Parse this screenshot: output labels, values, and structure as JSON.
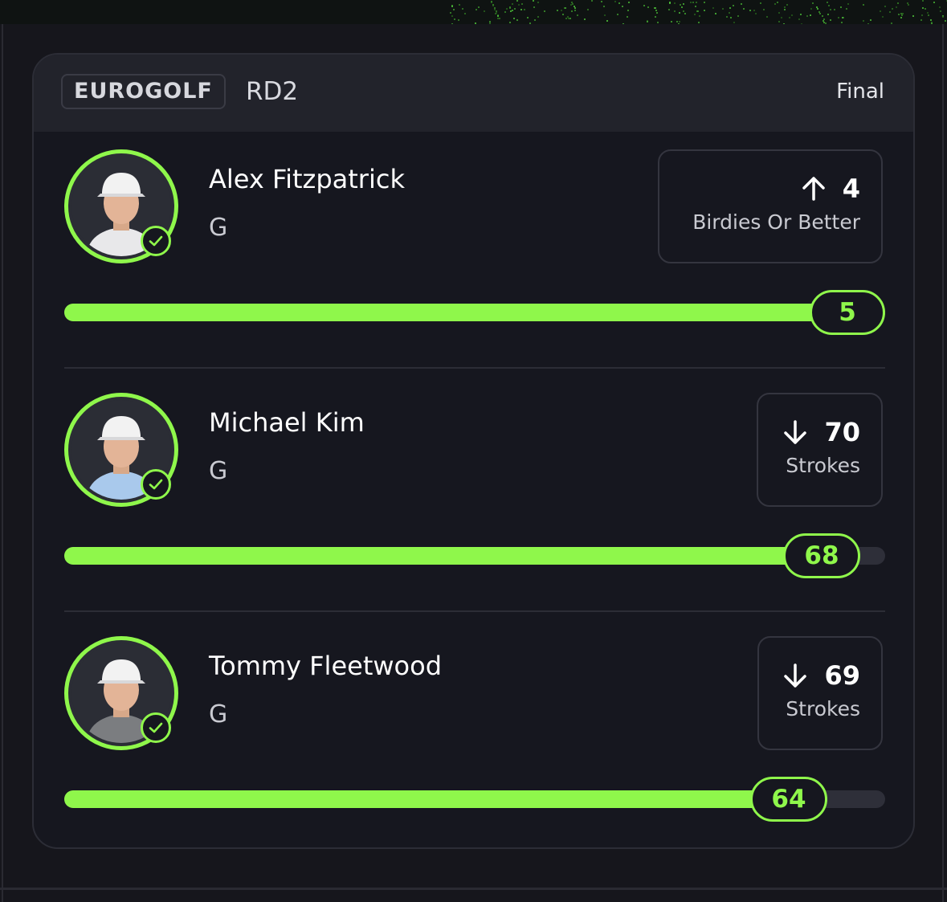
{
  "header": {
    "league": "EUROGOLF",
    "round": "RD2",
    "status": "Final"
  },
  "players": [
    {
      "name": "Alex Fitzpatrick",
      "position": "G",
      "direction": "up",
      "line": "4",
      "stat_label": "Birdies Or Better",
      "current_value": "5",
      "progress_fraction": 1.0,
      "shirt_color": "#e8e8ea",
      "cap_color": "#f2f2f2"
    },
    {
      "name": "Michael Kim",
      "position": "G",
      "direction": "down",
      "line": "70",
      "stat_label": "Strokes",
      "current_value": "68",
      "progress_fraction": 0.97,
      "shirt_color": "#a9c9ec",
      "cap_color": "#f2f2f2"
    },
    {
      "name": "Tommy Fleetwood",
      "position": "G",
      "direction": "down",
      "line": "69",
      "stat_label": "Strokes",
      "current_value": "64",
      "progress_fraction": 0.93,
      "shirt_color": "#7b7d80",
      "cap_color": "#f2f2f2"
    }
  ],
  "colors": {
    "accent": "#8ff74b",
    "background": "#16171f",
    "header": "#22232b"
  }
}
